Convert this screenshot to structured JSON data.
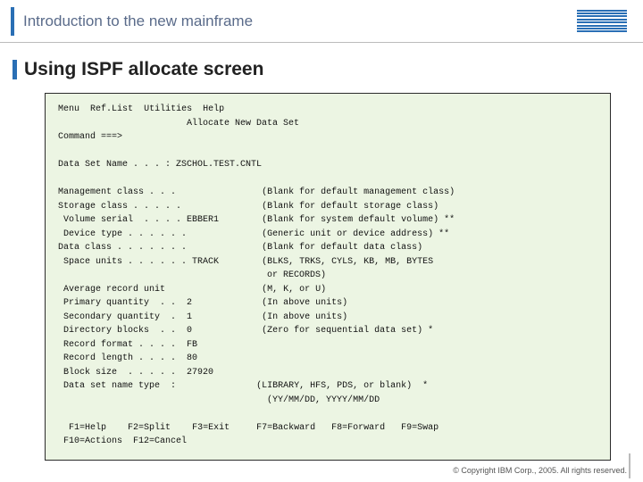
{
  "header": {
    "title": "Introduction to the new mainframe"
  },
  "slide": {
    "title": "Using ISPF allocate screen"
  },
  "terminal": {
    "menu": {
      "m1": "Menu",
      "m2": "Ref.List",
      "m3": "Utilities",
      "m4": "Help"
    },
    "screen_title": "Allocate New Data Set",
    "command_label": "Command ===>",
    "dsn_label": "Data Set Name",
    "dsn_dots": " . . . :",
    "dsn_value": "ZSCHOL.TEST.CNTL",
    "rows": [
      {
        "label": "Management class .",
        "dots": " . . ",
        "val": "",
        "hint": "(Blank for default management class)"
      },
      {
        "label": "Storage class . . .",
        "dots": " . . ",
        "val": "",
        "hint": "(Blank for default storage class)"
      },
      {
        "label": " Volume serial  . .",
        "dots": " . . ",
        "val": "EBBER1",
        "hint": "(Blank for system default volume) **"
      },
      {
        "label": " Device type . . . .",
        "dots": " . . ",
        "val": "",
        "hint": "(Generic unit or device address) **"
      },
      {
        "label": "Data class . . . . .",
        "dots": " . . ",
        "val": "",
        "hint": "(Blank for default data class)"
      },
      {
        "label": " Space units . . . .",
        "dots": " . . ",
        "val": "TRACK",
        "hint": "(BLKS, TRKS, CYLS, KB, MB, BYTES"
      },
      {
        "label": "",
        "dots": "",
        "val": "",
        "hint": " or RECORDS)"
      },
      {
        "label": " Average record unit",
        "dots": "    ",
        "val": "",
        "hint": "(M, K, or U)"
      },
      {
        "label": " Primary quantity  .",
        "dots": " .  ",
        "val": "2",
        "hint": "(In above units)"
      },
      {
        "label": " Secondary quantity ",
        "dots": " .  ",
        "val": "1",
        "hint": "(In above units)"
      },
      {
        "label": " Directory blocks  .",
        "dots": " .  ",
        "val": "0",
        "hint": "(Zero for sequential data set) *"
      },
      {
        "label": " Record format . . .",
        "dots": " .  ",
        "val": "FB",
        "hint": ""
      },
      {
        "label": " Record length . . .",
        "dots": " .  ",
        "val": "80",
        "hint": ""
      },
      {
        "label": " Block size  . . . .",
        "dots": " .  ",
        "val": "27920",
        "hint": ""
      },
      {
        "label": " Data set name type ",
        "dots": " :  ",
        "val": "",
        "hint": "(LIBRARY, HFS, PDS, or blank)  *"
      },
      {
        "label": "",
        "dots": "",
        "val": "",
        "hint": "(YY/MM/DD, YYYY/MM/DD"
      }
    ],
    "fkeys": {
      "f1": "F1=Help",
      "f2": "F2=Split",
      "f3": "F3=Exit",
      "f7": "F7=Backward",
      "f8": "F8=Forward",
      "f9": "F9=Swap",
      "f10": "F10=Actions",
      "f12": "F12=Cancel"
    }
  },
  "footer": {
    "copyright": "© Copyright IBM Corp., 2005. All rights reserved."
  }
}
